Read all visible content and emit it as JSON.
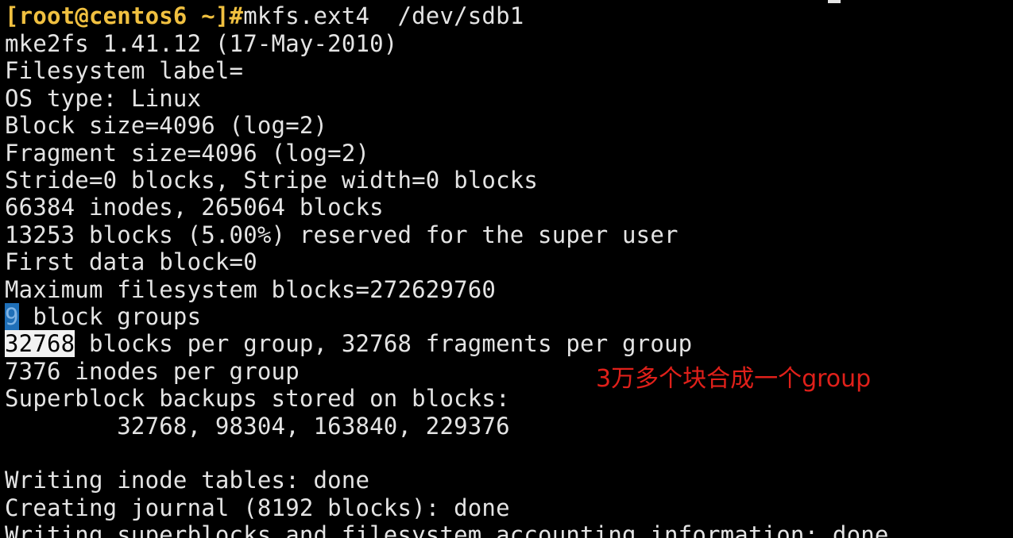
{
  "terminal": {
    "prompt": "[root@centos6 ~]#",
    "command": "mkfs.ext4  /dev/sdb1",
    "lines": [
      "mke2fs 1.41.12 (17-May-2010)",
      "Filesystem label=",
      "OS type: Linux",
      "Block size=4096 (log=2)",
      "Fragment size=4096 (log=2)",
      "Stride=0 blocks, Stripe width=0 blocks",
      "66384 inodes, 265064 blocks",
      "13253 blocks (5.00%) reserved for the super user",
      "First data block=0",
      "Maximum filesystem blocks=272629760"
    ],
    "block_groups": {
      "count": "9",
      "rest": " block groups"
    },
    "blocks_per_group": {
      "value": "32768",
      "rest": " blocks per group, 32768 fragments per group"
    },
    "lines_after": [
      "7376 inodes per group",
      "Superblock backups stored on blocks:",
      "        32768, 98304, 163840, 229376",
      "",
      "Writing inode tables: done",
      "Creating journal (8192 blocks): done",
      "Writing superblocks and filesystem accounting information: done"
    ]
  },
  "annotation": {
    "text": "3万多个块合成一个group",
    "color": "#e0201a"
  },
  "colors": {
    "background": "#000000",
    "foreground": "#e4e4e4",
    "prompt": "#f0c040",
    "selection_blue": "#1f6fb8"
  }
}
